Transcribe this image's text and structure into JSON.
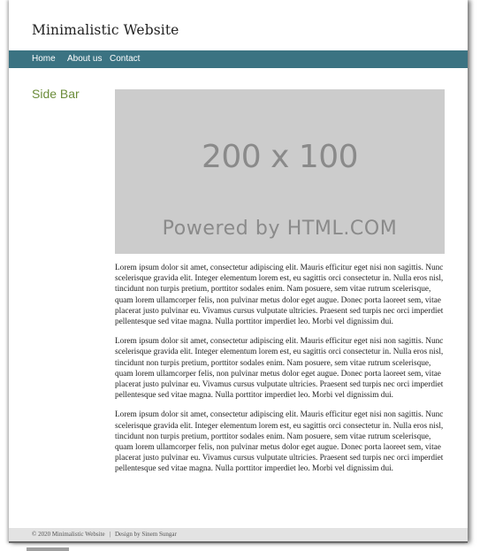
{
  "header": {
    "site_title": "Minimalistic Website"
  },
  "nav": {
    "items": [
      {
        "label": "Home"
      },
      {
        "label": "About us"
      },
      {
        "label": "Contact"
      }
    ]
  },
  "sidebar": {
    "title": "Side Bar"
  },
  "main": {
    "placeholder": {
      "size_text": "200 x 100",
      "powered_text": "Powered by HTML.COM"
    },
    "paragraphs": [
      "Lorem ipsum dolor sit amet, consectetur adipiscing elit. Mauris efficitur eget nisi non sagittis. Nunc scelerisque gravida elit. Integer elementum lorem est, eu sagittis orci consectetur in. Nulla eros nisl, tincidunt non turpis pretium, porttitor sodales enim. Nam posuere, sem vitae rutrum scelerisque, quam lorem ullamcorper felis, non pulvinar metus dolor eget augue. Donec porta laoreet sem, vitae placerat justo pulvinar eu. Vivamus cursus vulputate ultricies. Praesent sed turpis nec orci imperdiet pellentesque sed vitae magna. Nulla porttitor imperdiet leo. Morbi vel dignissim dui.",
      "Lorem ipsum dolor sit amet, consectetur adipiscing elit. Mauris efficitur eget nisi non sagittis. Nunc scelerisque gravida elit. Integer elementum lorem est, eu sagittis orci consectetur in. Nulla eros nisl, tincidunt non turpis pretium, porttitor sodales enim. Nam posuere, sem vitae rutrum scelerisque, quam lorem ullamcorper felis, non pulvinar metus dolor eget augue. Donec porta laoreet sem, vitae placerat justo pulvinar eu. Vivamus cursus vulputate ultricies. Praesent sed turpis nec orci imperdiet pellentesque sed vitae magna. Nulla porttitor imperdiet leo. Morbi vel dignissim dui.",
      "Lorem ipsum dolor sit amet, consectetur adipiscing elit. Mauris efficitur eget nisi non sagittis. Nunc scelerisque gravida elit. Integer elementum lorem est, eu sagittis orci consectetur in. Nulla eros nisl, tincidunt non turpis pretium, porttitor sodales enim. Nam posuere, sem vitae rutrum scelerisque, quam lorem ullamcorper felis, non pulvinar metus dolor eget augue. Donec porta laoreet sem, vitae placerat justo pulvinar eu. Vivamus cursus vulputate ultricies. Praesent sed turpis nec orci imperdiet pellentesque sed vitae magna. Nulla porttitor imperdiet leo. Morbi vel dignissim dui."
    ]
  },
  "footer": {
    "copyright": "© 2020 Minimalistic Website",
    "separator": "|",
    "credit": "Design by Sinem Sungar"
  },
  "colors": {
    "nav_background": "#3b7382",
    "sidebar_title": "#6b8c3a",
    "footer_background": "#e3e3e3",
    "placeholder_background": "#cccccc"
  }
}
